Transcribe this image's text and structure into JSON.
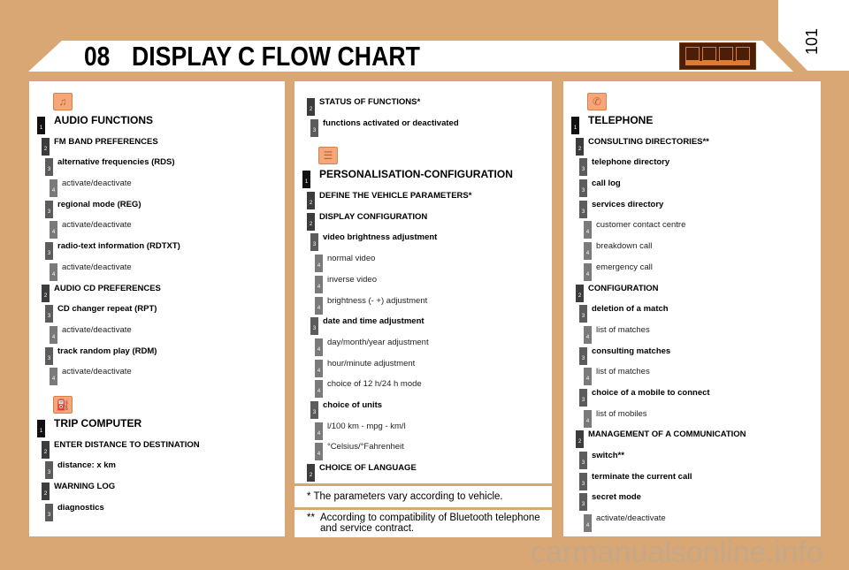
{
  "header": {
    "chapter": "08",
    "title": "DISPLAY C FLOW CHART",
    "page_number": "101",
    "icons": [
      "radio-icon",
      "personalisation-icon",
      "settings-icon",
      "telephone-icon"
    ]
  },
  "colors": {
    "background": "#d9a774",
    "level1": "#111111",
    "level2": "#3c3c3c",
    "level3": "#5c5c5c",
    "level4": "#7a7a7a",
    "icon_fill": "#f3a77a"
  },
  "panels": [
    {
      "items": [
        {
          "icon": "radio-icon"
        },
        {
          "level": 1,
          "text": "AUDIO FUNCTIONS"
        },
        {
          "level": 2,
          "text": "FM BAND PREFERENCES"
        },
        {
          "level": 3,
          "text": "alternative frequencies (RDS)"
        },
        {
          "level": 4,
          "text": "activate/deactivate"
        },
        {
          "level": 3,
          "text": "regional mode (REG)"
        },
        {
          "level": 4,
          "text": "activate/deactivate"
        },
        {
          "level": 3,
          "text": "radio-text information (RDTXT)"
        },
        {
          "level": 4,
          "text": "activate/deactivate"
        },
        {
          "level": 2,
          "text": "AUDIO CD PREFERENCES"
        },
        {
          "level": 3,
          "text": "CD changer repeat (RPT)"
        },
        {
          "level": 4,
          "text": "activate/deactivate"
        },
        {
          "level": 3,
          "text": "track random play (RDM)"
        },
        {
          "level": 4,
          "text": "activate/deactivate"
        },
        {
          "icon": "trip-computer-icon",
          "gap": true
        },
        {
          "level": 1,
          "text": "TRIP COMPUTER"
        },
        {
          "level": 2,
          "text": "ENTER DISTANCE TO DESTINATION"
        },
        {
          "level": 3,
          "text": "distance: x km"
        },
        {
          "level": 2,
          "text": "WARNING LOG"
        },
        {
          "level": 3,
          "text": "diagnostics"
        }
      ]
    },
    {
      "items": [
        {
          "level": 2,
          "text": "STATUS OF FUNCTIONS*"
        },
        {
          "level": 3,
          "text": "functions activated or deactivated"
        },
        {
          "icon": "personalisation-icon",
          "gap": true
        },
        {
          "level": 1,
          "text": "PERSONALISATION-CONFIGURATION"
        },
        {
          "level": 2,
          "text": "DEFINE THE VEHICLE PARAMETERS*"
        },
        {
          "level": 2,
          "text": "DISPLAY CONFIGURATION"
        },
        {
          "level": 3,
          "text": "video brightness adjustment"
        },
        {
          "level": 4,
          "text": "normal video"
        },
        {
          "level": 4,
          "text": "inverse video"
        },
        {
          "level": 4,
          "text": "brightness (- +) adjustment"
        },
        {
          "level": 3,
          "text": "date and time adjustment"
        },
        {
          "level": 4,
          "text": "day/month/year adjustment"
        },
        {
          "level": 4,
          "text": "hour/minute adjustment"
        },
        {
          "level": 4,
          "text": "choice of 12 h/24 h mode"
        },
        {
          "level": 3,
          "text": "choice of units"
        },
        {
          "level": 4,
          "text": "l/100 km - mpg - km/l"
        },
        {
          "level": 4,
          "text": "°Celsius/°Fahrenheit"
        },
        {
          "level": 2,
          "text": "CHOICE OF LANGUAGE"
        }
      ]
    },
    {
      "items": [
        {
          "icon": "telephone-icon"
        },
        {
          "level": 1,
          "text": "TELEPHONE"
        },
        {
          "level": 2,
          "text": "CONSULTING DIRECTORIES**"
        },
        {
          "level": 3,
          "text": "telephone directory"
        },
        {
          "level": 3,
          "text": "call log"
        },
        {
          "level": 3,
          "text": "services directory"
        },
        {
          "level": 4,
          "text": "customer contact centre"
        },
        {
          "level": 4,
          "text": "breakdown call"
        },
        {
          "level": 4,
          "text": "emergency call"
        },
        {
          "level": 2,
          "text": "CONFIGURATION"
        },
        {
          "level": 3,
          "text": "deletion of a match"
        },
        {
          "level": 4,
          "text": "list of matches"
        },
        {
          "level": 3,
          "text": "consulting matches"
        },
        {
          "level": 4,
          "text": "list of matches"
        },
        {
          "level": 3,
          "text": "choice of a mobile to connect"
        },
        {
          "level": 4,
          "text": "list of mobiles"
        },
        {
          "level": 2,
          "text": "MANAGEMENT OF A COMMUNICATION"
        },
        {
          "level": 3,
          "text": "switch**"
        },
        {
          "level": 3,
          "text": "terminate the current call"
        },
        {
          "level": 3,
          "text": "secret mode"
        },
        {
          "level": 4,
          "text": "activate/deactivate"
        }
      ]
    }
  ],
  "notes": {
    "note1_mark": "*",
    "note1": "The parameters vary according to vehicle.",
    "note2_mark": "**",
    "note2_line1": "According to compatibility of Bluetooth telephone",
    "note2_line2": "and service contract."
  },
  "watermark": "carmanualsonline.info"
}
